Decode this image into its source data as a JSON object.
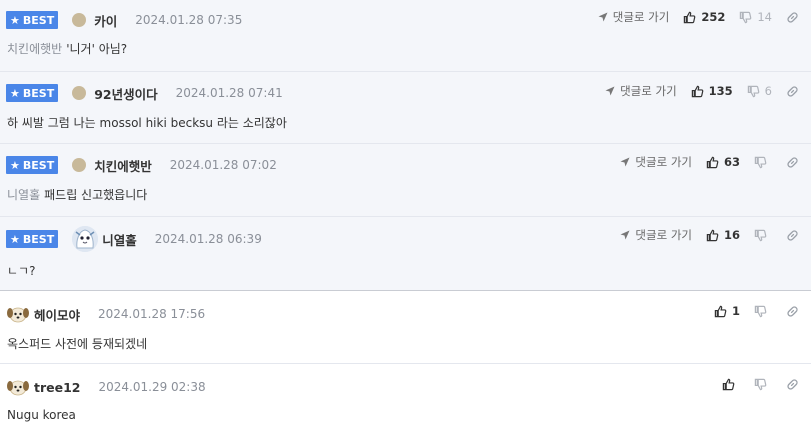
{
  "comments": [
    {
      "best": true,
      "best_label": "BEST",
      "avatar": "dot",
      "nickname": "카이",
      "date": "2024.01.28 07:35",
      "mention": "치킨에햇반",
      "text": "'니거' 아님?",
      "reply_label": "댓글로 가기",
      "likes": "252",
      "dislikes": "14"
    },
    {
      "best": true,
      "best_label": "BEST",
      "avatar": "dot",
      "nickname": "92년생이다",
      "date": "2024.01.28 07:41",
      "mention": "",
      "text": "하 씨발 그럼 나는 mossol hiki becksu 라는 소리잖아",
      "reply_label": "댓글로 가기",
      "likes": "135",
      "dislikes": "6"
    },
    {
      "best": true,
      "best_label": "BEST",
      "avatar": "dot",
      "nickname": "치킨에햇반",
      "date": "2024.01.28 07:02",
      "mention": "니열홀",
      "text": "패드립 신고했읍니다",
      "reply_label": "댓글로 가기",
      "likes": "63",
      "dislikes": ""
    },
    {
      "best": true,
      "best_label": "BEST",
      "avatar": "character",
      "nickname": "니열홀",
      "date": "2024.01.28 06:39",
      "mention": "",
      "text": "ㄴㄱ?",
      "reply_label": "댓글로 가기",
      "likes": "16",
      "dislikes": ""
    },
    {
      "best": false,
      "avatar": "dog",
      "nickname": "헤이모야",
      "date": "2024.01.28 17:56",
      "mention": "",
      "text": "옥스퍼드 사전에 등재되겠네",
      "likes": "1",
      "dislikes": ""
    },
    {
      "best": false,
      "avatar": "dog",
      "nickname": "tree12",
      "date": "2024.01.29 02:38",
      "mention": "",
      "text": "Nugu korea",
      "likes": "",
      "dislikes": ""
    }
  ],
  "icons": {
    "star": "star-icon",
    "reply": "paper-plane-icon",
    "like": "thumbs-up-icon",
    "dislike": "thumbs-down-icon",
    "share": "link-icon"
  },
  "colors": {
    "best_badge": "#4a86e8",
    "best_row_bg": "#f4f6fa",
    "meta_gray": "#8a8f98"
  }
}
